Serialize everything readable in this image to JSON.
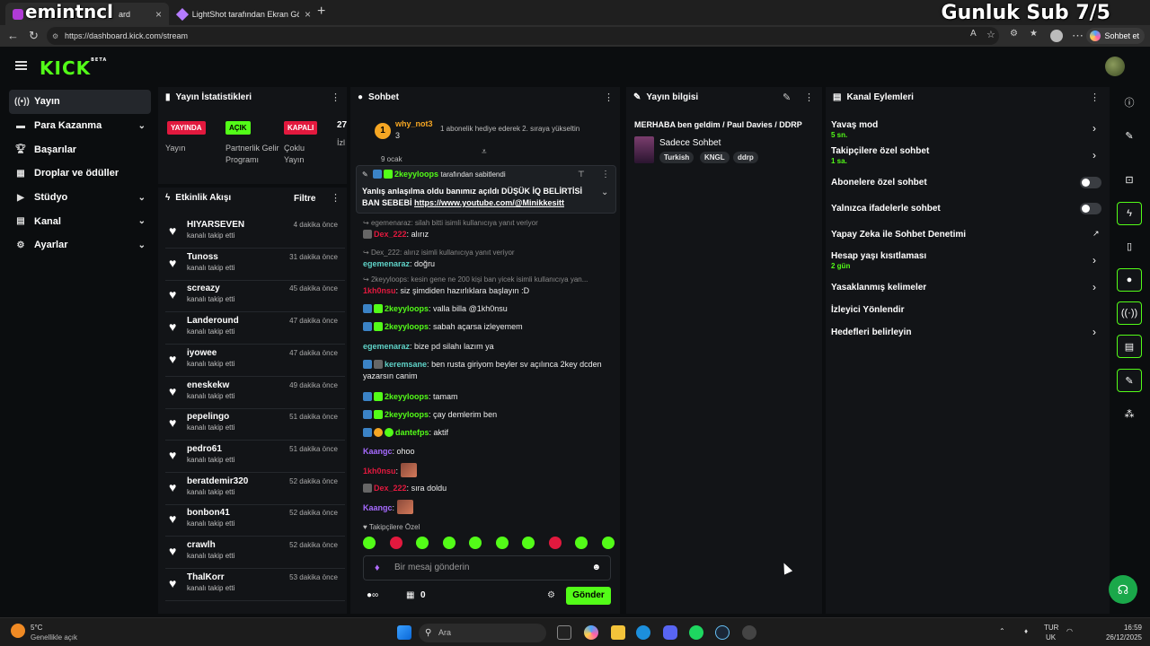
{
  "browser": {
    "tabs": [
      {
        "label": "ard"
      },
      {
        "label": "LightShot tarafından Ekran Görün"
      }
    ],
    "new_tab_icon": "plus-icon",
    "url": "https://dashboard.kick.com/stream",
    "chat_button_label": "Sohbet et"
  },
  "overlays": {
    "left_text": "emintncl",
    "right_text": "Gunluk Sub 7/5"
  },
  "sidebar": {
    "items": [
      {
        "label": "Yayın",
        "icon": "broadcast-icon"
      },
      {
        "label": "Para Kazanma",
        "icon": "money-icon"
      },
      {
        "label": "Başarılar",
        "icon": "trophy-icon"
      },
      {
        "label": "Droplar ve ödüller",
        "icon": "gift-icon"
      },
      {
        "label": "Stüdyo",
        "icon": "video-icon"
      },
      {
        "label": "Kanal",
        "icon": "channel-icon"
      },
      {
        "label": "Ayarlar",
        "icon": "gear-icon"
      }
    ]
  },
  "stats": {
    "title": "Yayın İstatistikleri",
    "items": [
      {
        "badge": "YAYINDA",
        "label": "Yayın",
        "color": "#e2193e"
      },
      {
        "badge": "AÇIK",
        "label": "Partnerlik Gelir Programı",
        "color": "#53fc18"
      },
      {
        "badge": "KAPALI",
        "label": "Çoklu Yayın",
        "color": "#e2193e"
      }
    ],
    "extra_value": "27",
    "extra_label": "İzl"
  },
  "activity": {
    "title": "Etkinlik Akışı",
    "filter_label": "Filtre",
    "events": [
      {
        "name": "HIYARSEVEN",
        "sub": "kanalı takip etti",
        "time": "4 dakika önce"
      },
      {
        "name": "Tunoss",
        "sub": "kanalı takip etti",
        "time": "31 dakika önce"
      },
      {
        "name": "screazy",
        "sub": "kanalı takip etti",
        "time": "45 dakika önce"
      },
      {
        "name": "Landeround",
        "sub": "kanalı takip etti",
        "time": "47 dakika önce"
      },
      {
        "name": "iyowee",
        "sub": "kanalı takip etti",
        "time": "47 dakika önce"
      },
      {
        "name": "eneskekw",
        "sub": "kanalı takip etti",
        "time": "49 dakika önce"
      },
      {
        "name": "pepelingo",
        "sub": "kanalı takip etti",
        "time": "51 dakika önce"
      },
      {
        "name": "pedro61",
        "sub": "kanalı takip etti",
        "time": "51 dakika önce"
      },
      {
        "name": "beratdemir320",
        "sub": "kanalı takip etti",
        "time": "52 dakika önce"
      },
      {
        "name": "bonbon41",
        "sub": "kanalı takip etti",
        "time": "52 dakika önce"
      },
      {
        "name": "crawlh",
        "sub": "kanalı takip etti",
        "time": "52 dakika önce"
      },
      {
        "name": "ThalKorr",
        "sub": "kanalı takip etti",
        "time": "53 dakika önce"
      }
    ]
  },
  "chat": {
    "title": "Sohbet",
    "gift": {
      "user": "why_not3",
      "count": "3",
      "text": "1 abonelik hediye ederek 2. sıraya yükseltin"
    },
    "cut_line": "9 ocak",
    "pinned": {
      "by_user": "2keyyloops",
      "header": "tarafından sabitlendi",
      "text": "Yanlış anlaşılma oldu banımız açıldı DÜŞÜK İQ BELİRTİSİ BAN SEBEBİ",
      "link": "https://www.youtube.com/@Minikkesitt"
    },
    "messages": [
      {
        "reply": "egemenaraz: silah bitti isimli kullanıcıya yanıt veriyor",
        "user": "Dex_222",
        "text": "alırız",
        "ucls": "u-red"
      },
      {
        "reply": "Dex_222: alırız isimli kullanıcıya yanıt veriyor",
        "user": "egemenaraz",
        "text": "doğru",
        "ucls": "u-teal"
      },
      {
        "reply": "2keyyloops: kesin gene ne 200 kişi ban yicek isimli kullanıcıya yan...",
        "user": "1kh0nsu",
        "text": "siz şimdiden hazırlıklara başlayın :D",
        "ucls": "u-red"
      },
      {
        "user": "2keyyloops",
        "text": "valla billa @1kh0nsu",
        "ucls": "u-green"
      },
      {
        "user": "2keyyloops",
        "text": "sabah açarsa izleyemem",
        "ucls": "u-green"
      },
      {
        "user": "egemenaraz",
        "text": "bize pd silahı lazım ya",
        "ucls": "u-teal"
      },
      {
        "user": "keremsane",
        "text": "ben rusta giriyom beyler sv açılınca 2key dcden yazarsın canim",
        "ucls": "u-teal"
      },
      {
        "user": "2keyyloops",
        "text": "tamam",
        "ucls": "u-green"
      },
      {
        "user": "2keyyloops",
        "text": "çay demlerim ben",
        "ucls": "u-green"
      },
      {
        "user": "dantefps",
        "text": "aktif",
        "ucls": "u-green"
      },
      {
        "user": "Kaangc",
        "text": "ohoo",
        "ucls": "u-purple"
      },
      {
        "user": "1kh0nsu",
        "text": "",
        "ucls": "u-red"
      },
      {
        "user": "Dex_222",
        "text": "sıra doldu",
        "ucls": "u-red"
      },
      {
        "user": "Kaangc",
        "text": "",
        "ucls": "u-purple"
      }
    ],
    "followers_only_label": "Takipçilere Özel",
    "input_placeholder": "Bir mesaj gönderin",
    "points_value": "0",
    "send_label": "Gönder"
  },
  "stream_info": {
    "title": "Yayın bilgisi",
    "stream_title": "MERHABA ben geldim / Paul Davies / DDRP",
    "category": "Sadece Sohbet",
    "tags": [
      "Turkish",
      "KNGL",
      "ddrp"
    ]
  },
  "channel_actions": {
    "title": "Kanal Eylemleri",
    "items": [
      {
        "label": "Yavaş mod",
        "sub": "5 sn."
      },
      {
        "label": "Takipçilere özel sohbet",
        "sub": "1 sa."
      },
      {
        "label": "Abonelere özel sohbet",
        "sub": ""
      },
      {
        "label": "Yalnızca ifadelerle sohbet",
        "sub": ""
      },
      {
        "label": "Yapay Zeka ile Sohbet Denetimi",
        "sub": ""
      },
      {
        "label": "Hesap yaşı kısıtlaması",
        "sub": "2 gün"
      },
      {
        "label": "Yasaklanmış kelimeler",
        "sub": ""
      },
      {
        "label": "İzleyici Yönlendir",
        "sub": ""
      },
      {
        "label": "Hedefleri belirleyin",
        "sub": ""
      }
    ]
  },
  "taskbar": {
    "weather_temp": "5°C",
    "weather_text": "Genellikle açık",
    "search_placeholder": "Ara",
    "lang": "TUR",
    "region": "UK",
    "time": "16:59",
    "date": "26/12/2025"
  },
  "colors": {
    "brand": "#53fc18",
    "danger": "#e2193e",
    "panel": "#121417"
  }
}
